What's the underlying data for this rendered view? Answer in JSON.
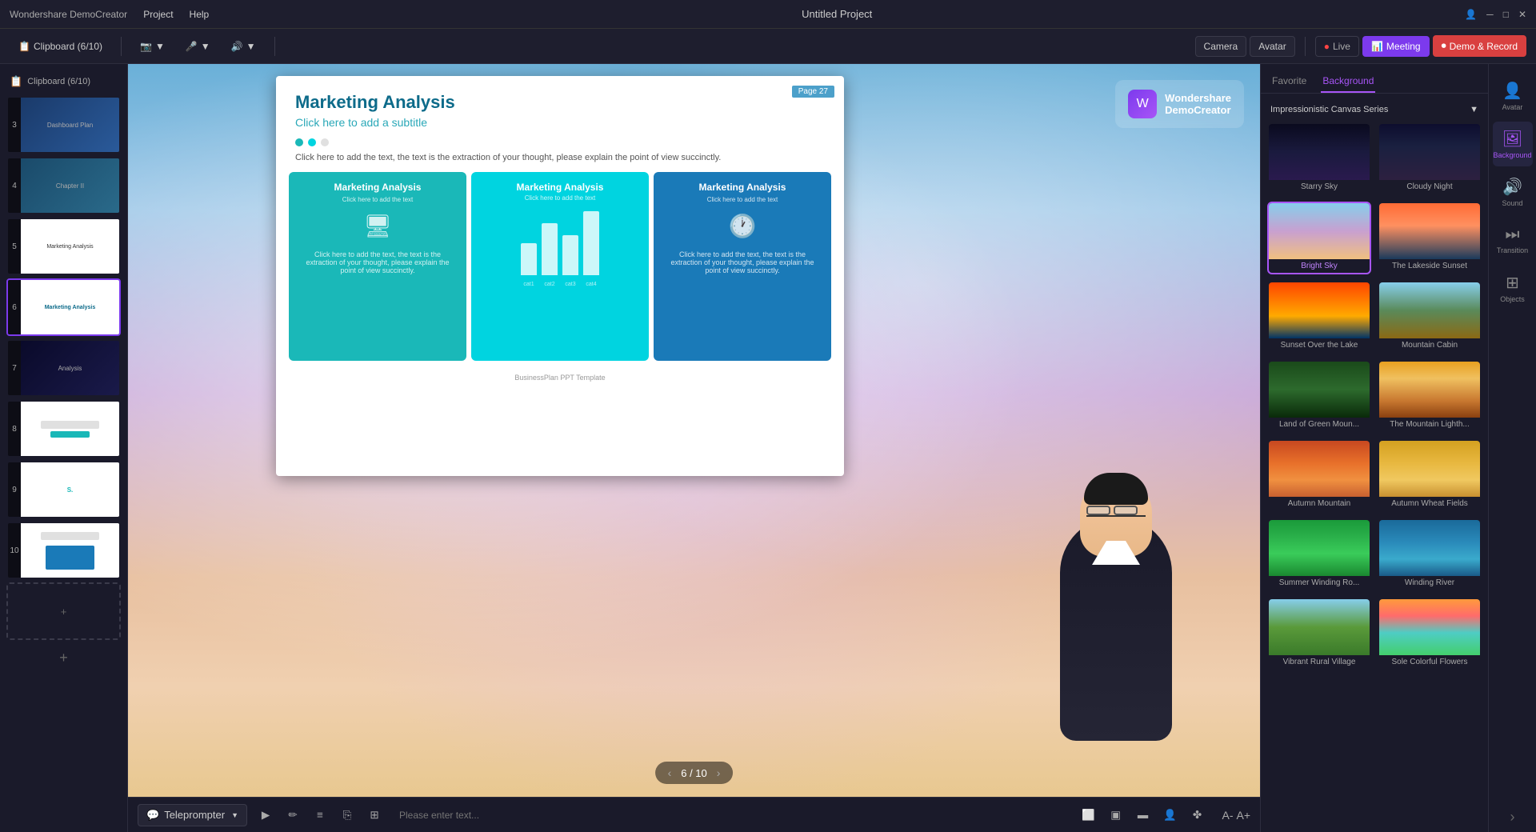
{
  "app": {
    "name": "Wondershare DemoCreator",
    "title": "Untitled Project"
  },
  "menu": {
    "items": [
      "Project",
      "Help"
    ]
  },
  "toolbar": {
    "camera": "Camera",
    "avatar": "Avatar",
    "live": "Live",
    "meeting": "Meeting",
    "demo_record": "Demo & Record",
    "clipboard": "Clipboard (6/10)"
  },
  "slides": [
    {
      "number": "3",
      "active": false
    },
    {
      "number": "4",
      "active": false
    },
    {
      "number": "5",
      "active": false
    },
    {
      "number": "6",
      "active": true
    },
    {
      "number": "7",
      "active": false
    },
    {
      "number": "8",
      "active": false
    },
    {
      "number": "9",
      "active": false
    },
    {
      "number": "10",
      "active": false
    }
  ],
  "canvas": {
    "page_label": "Page",
    "page_number": "27",
    "slide_title": "Marketing Analysis",
    "slide_subtitle": "Click here to add a subtitle",
    "slide_body": "Click here to add the text, the text is the extraction of your thought, please explain the point of view succinctly.",
    "card1_title": "Marketing Analysis",
    "card1_sub": "Click here to add the text, the text is the extraction of your thought, please explain the point of view succinctly.",
    "card2_title": "Marketing Analysis",
    "card2_sub": "Click here to add the text",
    "card3_title": "Marketing Analysis",
    "card3_sub": "Click here to add the text, the text is the extraction of your thought, please explain the point of view succinctly.",
    "footer": "BusinessPlan PPT Template",
    "watermark_line1": "Wondershare",
    "watermark_line2": "DemoCreator",
    "pagination": "6 / 10"
  },
  "bottom_bar": {
    "teleprompter_label": "Teleprompter",
    "placeholder": "Please enter text..."
  },
  "right_panel": {
    "tab_favorite": "Favorite",
    "tab_background": "Background",
    "series_label": "Impressionistic Canvas Series",
    "backgrounds": [
      {
        "id": "starry-sky",
        "label": "Starry Sky",
        "class": "bg-starry",
        "selected": false
      },
      {
        "id": "cloudy-night",
        "label": "Cloudy Night",
        "class": "bg-cloudy-night",
        "selected": false
      },
      {
        "id": "bright-sky",
        "label": "Bright Sky",
        "class": "bg-bright-sky",
        "selected": true
      },
      {
        "id": "the-lakeside-sunset",
        "label": "The Lakeside Sunset",
        "class": "bg-lakeside",
        "selected": false
      },
      {
        "id": "sunset-over-lake",
        "label": "Sunset Over the Lake",
        "class": "bg-sunset",
        "selected": false
      },
      {
        "id": "mountain-cabin",
        "label": "Mountain Cabin",
        "class": "bg-mountain-cabin",
        "selected": false
      },
      {
        "id": "land-green-mountain",
        "label": "Land of Green Moun...",
        "class": "bg-green-mountain",
        "selected": false
      },
      {
        "id": "mountain-lighthouse",
        "label": "The Mountain Lighth...",
        "class": "bg-mountain-light",
        "selected": false
      },
      {
        "id": "autumn-mountain",
        "label": "Autumn Mountain",
        "class": "bg-autumn-mountain",
        "selected": false
      },
      {
        "id": "autumn-wheat",
        "label": "Autumn Wheat Fields",
        "class": "bg-autumn-wheat",
        "selected": false
      },
      {
        "id": "summer-winding",
        "label": "Summer Winding Ro...",
        "class": "bg-summer-winding",
        "selected": false
      },
      {
        "id": "winding-river",
        "label": "Winding River",
        "class": "bg-winding-river",
        "selected": false
      },
      {
        "id": "vibrant-rural",
        "label": "Vibrant Rural Village",
        "class": "bg-vibrant-rural",
        "selected": false
      },
      {
        "id": "sole-colorful",
        "label": "Sole Colorful Flowers",
        "class": "bg-sole-colorful",
        "selected": false
      }
    ]
  },
  "right_sidebar": {
    "items": [
      {
        "id": "avatar",
        "icon": "👤",
        "label": "Avatar"
      },
      {
        "id": "background",
        "icon": "🖼",
        "label": "Background",
        "active": true
      },
      {
        "id": "sound",
        "icon": "🔊",
        "label": "Sound"
      },
      {
        "id": "transition",
        "icon": "▶",
        "label": "Transition"
      },
      {
        "id": "objects",
        "icon": "⊞",
        "label": "Objects"
      }
    ]
  }
}
